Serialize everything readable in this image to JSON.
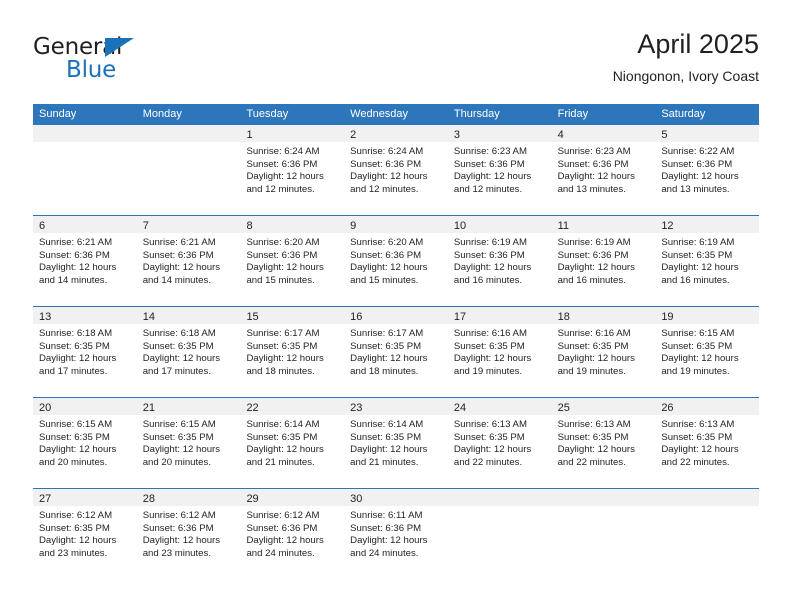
{
  "brand": {
    "name_top": "General",
    "name_bottom": "Blue",
    "accent_color": "#1b72b8"
  },
  "header": {
    "title": "April 2025",
    "subtitle": "Niongonon, Ivory Coast"
  },
  "calendar": {
    "header_color": "#2e76bc",
    "weekdays": [
      "Sunday",
      "Monday",
      "Tuesday",
      "Wednesday",
      "Thursday",
      "Friday",
      "Saturday"
    ],
    "weeks": [
      [
        {
          "day": "",
          "sunrise": "",
          "sunset": "",
          "daylight1": "",
          "daylight2": ""
        },
        {
          "day": "",
          "sunrise": "",
          "sunset": "",
          "daylight1": "",
          "daylight2": ""
        },
        {
          "day": "1",
          "sunrise": "Sunrise: 6:24 AM",
          "sunset": "Sunset: 6:36 PM",
          "daylight1": "Daylight: 12 hours",
          "daylight2": "and 12 minutes."
        },
        {
          "day": "2",
          "sunrise": "Sunrise: 6:24 AM",
          "sunset": "Sunset: 6:36 PM",
          "daylight1": "Daylight: 12 hours",
          "daylight2": "and 12 minutes."
        },
        {
          "day": "3",
          "sunrise": "Sunrise: 6:23 AM",
          "sunset": "Sunset: 6:36 PM",
          "daylight1": "Daylight: 12 hours",
          "daylight2": "and 12 minutes."
        },
        {
          "day": "4",
          "sunrise": "Sunrise: 6:23 AM",
          "sunset": "Sunset: 6:36 PM",
          "daylight1": "Daylight: 12 hours",
          "daylight2": "and 13 minutes."
        },
        {
          "day": "5",
          "sunrise": "Sunrise: 6:22 AM",
          "sunset": "Sunset: 6:36 PM",
          "daylight1": "Daylight: 12 hours",
          "daylight2": "and 13 minutes."
        }
      ],
      [
        {
          "day": "6",
          "sunrise": "Sunrise: 6:21 AM",
          "sunset": "Sunset: 6:36 PM",
          "daylight1": "Daylight: 12 hours",
          "daylight2": "and 14 minutes."
        },
        {
          "day": "7",
          "sunrise": "Sunrise: 6:21 AM",
          "sunset": "Sunset: 6:36 PM",
          "daylight1": "Daylight: 12 hours",
          "daylight2": "and 14 minutes."
        },
        {
          "day": "8",
          "sunrise": "Sunrise: 6:20 AM",
          "sunset": "Sunset: 6:36 PM",
          "daylight1": "Daylight: 12 hours",
          "daylight2": "and 15 minutes."
        },
        {
          "day": "9",
          "sunrise": "Sunrise: 6:20 AM",
          "sunset": "Sunset: 6:36 PM",
          "daylight1": "Daylight: 12 hours",
          "daylight2": "and 15 minutes."
        },
        {
          "day": "10",
          "sunrise": "Sunrise: 6:19 AM",
          "sunset": "Sunset: 6:36 PM",
          "daylight1": "Daylight: 12 hours",
          "daylight2": "and 16 minutes."
        },
        {
          "day": "11",
          "sunrise": "Sunrise: 6:19 AM",
          "sunset": "Sunset: 6:36 PM",
          "daylight1": "Daylight: 12 hours",
          "daylight2": "and 16 minutes."
        },
        {
          "day": "12",
          "sunrise": "Sunrise: 6:19 AM",
          "sunset": "Sunset: 6:35 PM",
          "daylight1": "Daylight: 12 hours",
          "daylight2": "and 16 minutes."
        }
      ],
      [
        {
          "day": "13",
          "sunrise": "Sunrise: 6:18 AM",
          "sunset": "Sunset: 6:35 PM",
          "daylight1": "Daylight: 12 hours",
          "daylight2": "and 17 minutes."
        },
        {
          "day": "14",
          "sunrise": "Sunrise: 6:18 AM",
          "sunset": "Sunset: 6:35 PM",
          "daylight1": "Daylight: 12 hours",
          "daylight2": "and 17 minutes."
        },
        {
          "day": "15",
          "sunrise": "Sunrise: 6:17 AM",
          "sunset": "Sunset: 6:35 PM",
          "daylight1": "Daylight: 12 hours",
          "daylight2": "and 18 minutes."
        },
        {
          "day": "16",
          "sunrise": "Sunrise: 6:17 AM",
          "sunset": "Sunset: 6:35 PM",
          "daylight1": "Daylight: 12 hours",
          "daylight2": "and 18 minutes."
        },
        {
          "day": "17",
          "sunrise": "Sunrise: 6:16 AM",
          "sunset": "Sunset: 6:35 PM",
          "daylight1": "Daylight: 12 hours",
          "daylight2": "and 19 minutes."
        },
        {
          "day": "18",
          "sunrise": "Sunrise: 6:16 AM",
          "sunset": "Sunset: 6:35 PM",
          "daylight1": "Daylight: 12 hours",
          "daylight2": "and 19 minutes."
        },
        {
          "day": "19",
          "sunrise": "Sunrise: 6:15 AM",
          "sunset": "Sunset: 6:35 PM",
          "daylight1": "Daylight: 12 hours",
          "daylight2": "and 19 minutes."
        }
      ],
      [
        {
          "day": "20",
          "sunrise": "Sunrise: 6:15 AM",
          "sunset": "Sunset: 6:35 PM",
          "daylight1": "Daylight: 12 hours",
          "daylight2": "and 20 minutes."
        },
        {
          "day": "21",
          "sunrise": "Sunrise: 6:15 AM",
          "sunset": "Sunset: 6:35 PM",
          "daylight1": "Daylight: 12 hours",
          "daylight2": "and 20 minutes."
        },
        {
          "day": "22",
          "sunrise": "Sunrise: 6:14 AM",
          "sunset": "Sunset: 6:35 PM",
          "daylight1": "Daylight: 12 hours",
          "daylight2": "and 21 minutes."
        },
        {
          "day": "23",
          "sunrise": "Sunrise: 6:14 AM",
          "sunset": "Sunset: 6:35 PM",
          "daylight1": "Daylight: 12 hours",
          "daylight2": "and 21 minutes."
        },
        {
          "day": "24",
          "sunrise": "Sunrise: 6:13 AM",
          "sunset": "Sunset: 6:35 PM",
          "daylight1": "Daylight: 12 hours",
          "daylight2": "and 22 minutes."
        },
        {
          "day": "25",
          "sunrise": "Sunrise: 6:13 AM",
          "sunset": "Sunset: 6:35 PM",
          "daylight1": "Daylight: 12 hours",
          "daylight2": "and 22 minutes."
        },
        {
          "day": "26",
          "sunrise": "Sunrise: 6:13 AM",
          "sunset": "Sunset: 6:35 PM",
          "daylight1": "Daylight: 12 hours",
          "daylight2": "and 22 minutes."
        }
      ],
      [
        {
          "day": "27",
          "sunrise": "Sunrise: 6:12 AM",
          "sunset": "Sunset: 6:35 PM",
          "daylight1": "Daylight: 12 hours",
          "daylight2": "and 23 minutes."
        },
        {
          "day": "28",
          "sunrise": "Sunrise: 6:12 AM",
          "sunset": "Sunset: 6:36 PM",
          "daylight1": "Daylight: 12 hours",
          "daylight2": "and 23 minutes."
        },
        {
          "day": "29",
          "sunrise": "Sunrise: 6:12 AM",
          "sunset": "Sunset: 6:36 PM",
          "daylight1": "Daylight: 12 hours",
          "daylight2": "and 24 minutes."
        },
        {
          "day": "30",
          "sunrise": "Sunrise: 6:11 AM",
          "sunset": "Sunset: 6:36 PM",
          "daylight1": "Daylight: 12 hours",
          "daylight2": "and 24 minutes."
        },
        {
          "day": "",
          "sunrise": "",
          "sunset": "",
          "daylight1": "",
          "daylight2": ""
        },
        {
          "day": "",
          "sunrise": "",
          "sunset": "",
          "daylight1": "",
          "daylight2": ""
        },
        {
          "day": "",
          "sunrise": "",
          "sunset": "",
          "daylight1": "",
          "daylight2": ""
        }
      ]
    ]
  }
}
